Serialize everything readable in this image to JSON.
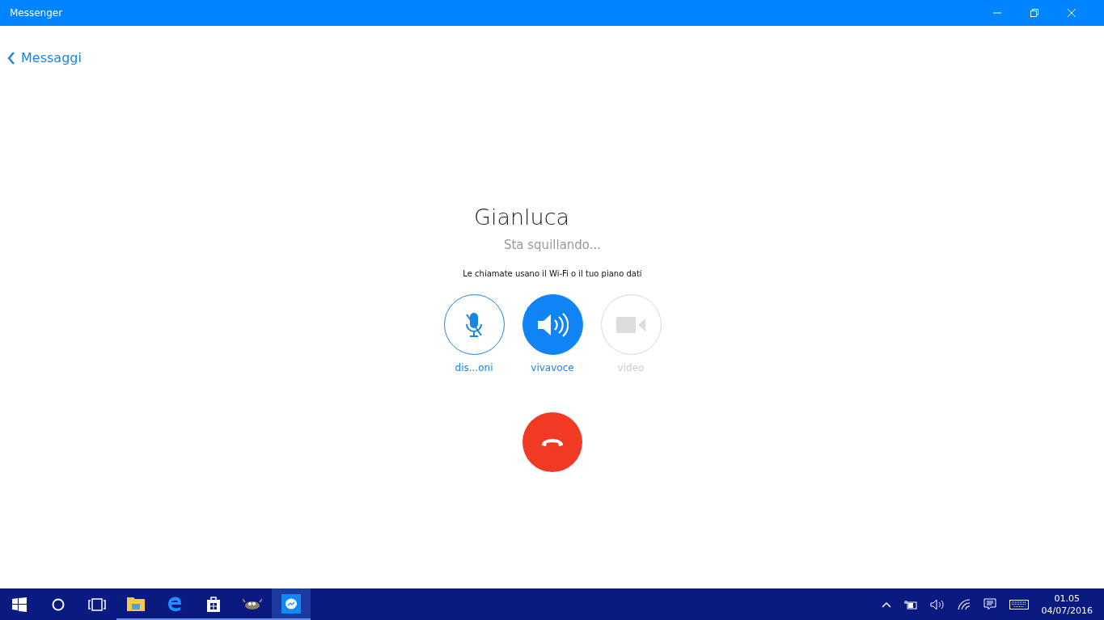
{
  "window": {
    "title": "Messenger"
  },
  "back_link": {
    "label": "Messaggi"
  },
  "call": {
    "contact": "Gianluca",
    "status": "Sta squillando...",
    "notice": "Le chiamate usano il Wi-Fi o il tuo piano dati"
  },
  "controls": [
    {
      "kind": "mute",
      "label": "dis...oni",
      "on": false,
      "disabled": false
    },
    {
      "kind": "speaker",
      "label": "vivavoce",
      "on": true,
      "disabled": false
    },
    {
      "kind": "video",
      "label": "video",
      "on": false,
      "disabled": true
    }
  ],
  "taskbar": {
    "apps": [
      {
        "kind": "explorer",
        "running": true,
        "selected": false
      },
      {
        "kind": "edge",
        "running": true,
        "selected": false
      },
      {
        "kind": "store",
        "running": true,
        "selected": false
      },
      {
        "kind": "gimp",
        "running": true,
        "selected": false
      },
      {
        "kind": "messenger",
        "running": true,
        "selected": true
      }
    ],
    "time": "01.05",
    "date": "04/07/2016"
  }
}
